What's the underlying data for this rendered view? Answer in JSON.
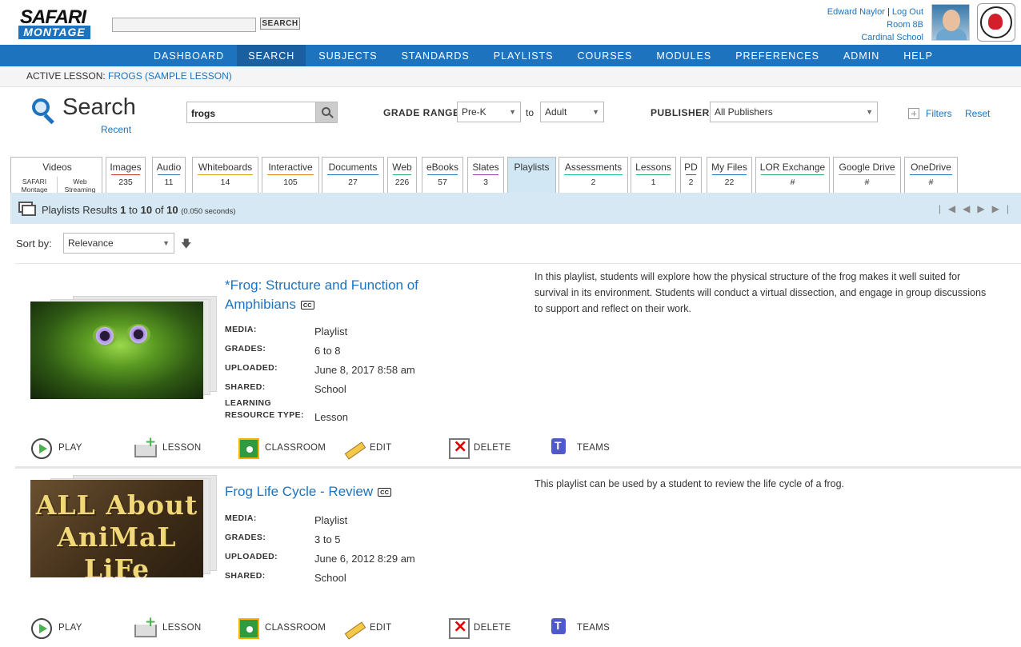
{
  "header": {
    "logo_top": "SAFARI",
    "logo_bottom": "MONTAGE",
    "search_button": "SEARCH",
    "user_name": "Edward Naylor",
    "separator": "|",
    "logout": "Log Out",
    "room": "Room 8B",
    "school": "Cardinal School"
  },
  "nav": [
    "DASHBOARD",
    "SEARCH",
    "SUBJECTS",
    "STANDARDS",
    "PLAYLISTS",
    "COURSES",
    "MODULES",
    "PREFERENCES",
    "ADMIN",
    "HELP"
  ],
  "active_lesson": {
    "label": "ACTIVE LESSON:",
    "value": "FROGS (SAMPLE LESSON)"
  },
  "search": {
    "title": "Search",
    "recent": "Recent",
    "query": "frogs",
    "grade_label": "GRADE RANGE:",
    "grade_from": "Pre-K",
    "to": "to",
    "grade_to": "Adult",
    "publisher_label": "PUBLISHER:",
    "publisher": "All Publishers",
    "filters": "Filters",
    "reset": "Reset"
  },
  "videos_tab": {
    "label": "Videos",
    "sub1a": "SAFARI",
    "sub1b": "Montage",
    "sub2a": "Web",
    "sub2b": "Streaming"
  },
  "tabs": [
    {
      "label": "Images",
      "count": "235",
      "color": "#c0392b"
    },
    {
      "label": "Audio",
      "count": "11",
      "color": "#3a6ea5"
    },
    {
      "label": "Whiteboards",
      "count": "14",
      "color": "#d4a017"
    },
    {
      "label": "Interactive",
      "count": "105",
      "color": "#e67e22"
    },
    {
      "label": "Documents",
      "count": "27",
      "color": "#1e73be"
    },
    {
      "label": "Web",
      "count": "226",
      "color": "#27ae60"
    },
    {
      "label": "eBooks",
      "count": "57",
      "color": "#2980b9"
    },
    {
      "label": "Slates",
      "count": "3",
      "color": "#8e44ad"
    },
    {
      "label": "Playlists",
      "count": "",
      "color": "#d1e7f3"
    },
    {
      "label": "Assessments",
      "count": "2",
      "color": "#1abc9c"
    },
    {
      "label": "Lessons",
      "count": "1",
      "color": "#27ae60"
    },
    {
      "label": "PD",
      "count": "2",
      "color": "#555555"
    },
    {
      "label": "My Files",
      "count": "22",
      "color": "#1e73be"
    },
    {
      "label": "LOR Exchange",
      "count": "#",
      "color": "#27ae60"
    },
    {
      "label": "Google Drive",
      "count": "#",
      "color": "#999999"
    },
    {
      "label": "OneDrive",
      "count": "#",
      "color": "#1e73be"
    }
  ],
  "results": {
    "prefix": "Playlists Results",
    "from": "1",
    "to_word": "to",
    "to": "10",
    "of_word": "of",
    "total": "10",
    "time": "(0.050 seconds)"
  },
  "sort": {
    "label": "Sort by:",
    "value": "Relevance"
  },
  "items": [
    {
      "title": "*Frog: Structure and Function of Amphibians",
      "cc": "CC",
      "meta": [
        {
          "label": "MEDIA:",
          "value": "Playlist"
        },
        {
          "label": "GRADES:",
          "value": "6 to 8"
        },
        {
          "label": "UPLOADED:",
          "value": "June 8, 2017 8:58 am"
        },
        {
          "label": "SHARED:",
          "value": "School"
        },
        {
          "label": "LEARNING RESOURCE TYPE:",
          "value": "Lesson"
        }
      ],
      "description": "In this playlist, students will explore how the physical structure of the frog makes it well suited for survival in its environment. Students will conduct a virtual dissection, and engage in group discussions to support and reflect on their work."
    },
    {
      "title": "Frog Life Cycle - Review",
      "cc": "CC",
      "thumb_text": [
        "ALL About",
        "AniMaL",
        "LiFe CycLes"
      ],
      "meta": [
        {
          "label": "MEDIA:",
          "value": "Playlist"
        },
        {
          "label": "GRADES:",
          "value": "3 to 5"
        },
        {
          "label": "UPLOADED:",
          "value": "June 6, 2012 8:29 am"
        },
        {
          "label": "SHARED:",
          "value": "School"
        }
      ],
      "description": "This playlist can be used by a student to review the life cycle of a frog."
    }
  ],
  "actions": [
    "PLAY",
    "LESSON",
    "CLASSROOM",
    "EDIT",
    "DELETE",
    "TEAMS"
  ]
}
